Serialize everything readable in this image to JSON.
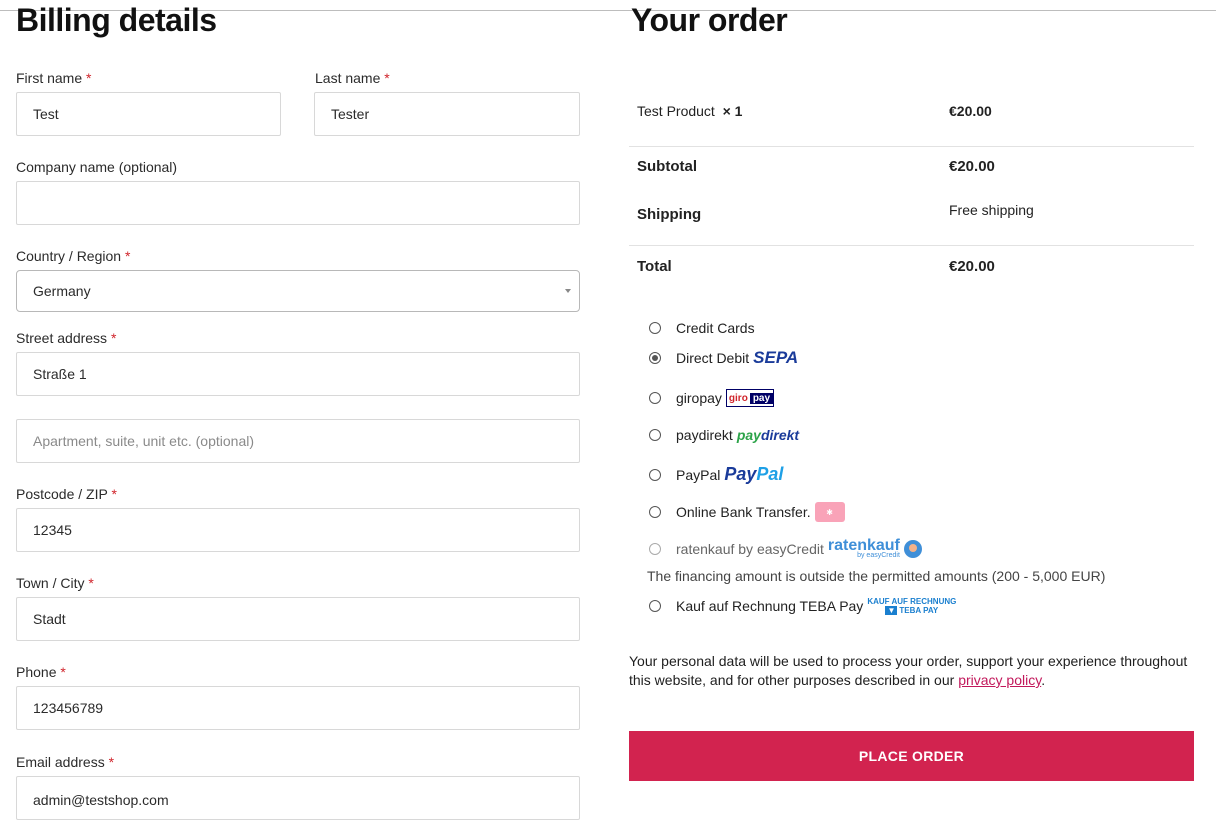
{
  "billing": {
    "title": "Billing details",
    "first_name": {
      "label": "First name",
      "value": "Test"
    },
    "last_name": {
      "label": "Last name",
      "value": "Tester"
    },
    "company": {
      "label": "Company name (optional)",
      "value": ""
    },
    "country": {
      "label": "Country / Region",
      "value": "Germany"
    },
    "street": {
      "label": "Street address",
      "value": "Straße 1",
      "apartment_placeholder": "Apartment, suite, unit etc. (optional)"
    },
    "postcode": {
      "label": "Postcode / ZIP",
      "value": "12345"
    },
    "city": {
      "label": "Town / City",
      "value": "Stadt"
    },
    "phone": {
      "label": "Phone",
      "value": "123456789"
    },
    "email": {
      "label": "Email address",
      "value": "admin@testshop.com"
    },
    "required_mark": "*"
  },
  "order": {
    "title": "Your order",
    "product": {
      "name": "Test Product",
      "qty": "× 1",
      "price": "€20.00"
    },
    "subtotal": {
      "label": "Subtotal",
      "value": "€20.00"
    },
    "shipping": {
      "label": "Shipping",
      "value": "Free shipping"
    },
    "total": {
      "label": "Total",
      "value": "€20.00"
    }
  },
  "payment": {
    "methods": [
      {
        "label": "Credit Cards",
        "checked": false
      },
      {
        "label": "Direct Debit",
        "logo_text": "SEPA",
        "checked": true
      },
      {
        "label": "giropay",
        "logo_a": "giro",
        "logo_b": "pay"
      },
      {
        "label": "paydirekt",
        "logo_a": "pay",
        "logo_b": "direkt"
      },
      {
        "label": "PayPal",
        "logo_a": "Pay",
        "logo_b": "Pal"
      },
      {
        "label": "Online Bank Transfer."
      },
      {
        "label": "ratenkauf by easyCredit",
        "logo_a": "ratenkauf",
        "logo_b": "by easyCredit",
        "disabled": true
      },
      {
        "label": "Kauf auf Rechnung TEBA Pay",
        "logo_a": "KAUF AUF RECHNUNG",
        "logo_b": "TEBA PAY"
      }
    ],
    "financing_note": "The financing amount is outside the permitted amounts (200 - 5,000 EUR)"
  },
  "privacy": {
    "text": "Your personal data will be used to process your order, support your experience throughout this website, and for other purposes described in our ",
    "link": "privacy policy",
    "end": "."
  },
  "place_order": "PLACE ORDER",
  "colors": {
    "accent": "#d2234f",
    "required": "#d0242b"
  }
}
